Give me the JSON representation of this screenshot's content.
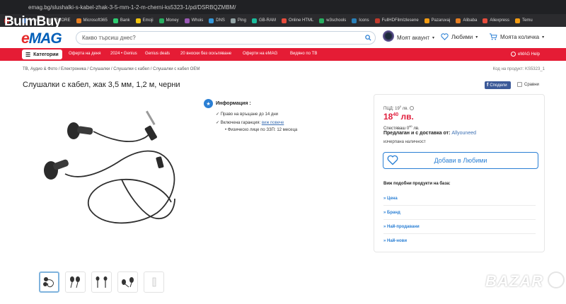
{
  "browser": {
    "url": "emag.bg/slushalki-s-kabel-zhak-3-5-mm-1-2-m-cherni-ks5323-1/pd/DSRBQZMBM/"
  },
  "bookmarks": [
    {
      "label": "Yo",
      "color": "#e52a2a"
    },
    {
      "label": "Google",
      "color": "#4a8ef0"
    },
    {
      "label": "SCORE",
      "color": "#888888"
    },
    {
      "label": "Microsoft365",
      "color": "#e67e22"
    },
    {
      "label": "Bank",
      "color": "#2ecc71"
    },
    {
      "label": "Emoji",
      "color": "#f1c40f"
    },
    {
      "label": "Money",
      "color": "#27ae60"
    },
    {
      "label": "Whois",
      "color": "#9b59b6"
    },
    {
      "label": "DNS",
      "color": "#3498db"
    },
    {
      "label": "Ping",
      "color": "#95a5a6"
    },
    {
      "label": "GB-RAM",
      "color": "#1abc9c"
    },
    {
      "label": "Online HTML",
      "color": "#e74c3c"
    },
    {
      "label": "w3schools",
      "color": "#27ae60"
    },
    {
      "label": "Icons",
      "color": "#2980b9"
    },
    {
      "label": "FullHDFilmIzlesene",
      "color": "#c0392b"
    },
    {
      "label": "Pazaruvaj",
      "color": "#f39c12"
    },
    {
      "label": "Alibaba",
      "color": "#e67e22"
    },
    {
      "label": "Aliexpress",
      "color": "#e74c3c"
    },
    {
      "label": "Temu",
      "color": "#f39c12"
    }
  ],
  "watermarks": {
    "top": "BuimBuy",
    "bottom": "BAZAR"
  },
  "header": {
    "logo": "eMAG",
    "search_placeholder": "Какво търсиш днес?",
    "account_label": "Моят акаунт",
    "favorites_label": "Любими",
    "cart_label": "Моята количка"
  },
  "nav": {
    "categories_label": "Категории",
    "links": [
      "Оферта на деня",
      "2024 • Genius",
      "Genius deals",
      "20 вноски без оскъпяване",
      "Оферти на eMAG",
      "Видяно по ТВ"
    ],
    "help_label": "eMAG Help"
  },
  "breadcrumb": "ТВ, Аудио & Фото  /  Електроника  /  Слушалки  /  Слушалки с кабел  /  Слушалки с кабел OEM",
  "product_code": "Код на продукт: KS5323_1",
  "product": {
    "title": "Слушалки с кабел, жак 3,5 мм, 1,2 м, черни",
    "share_label": "Сподели",
    "compare_label": "Сравни"
  },
  "info": {
    "title": "Информация :",
    "return_text": "Право на връщане до 14 дни",
    "warranty_text": "Включена гаранция:",
    "warranty_link": "виж повече",
    "warranty_detail": "Физическо лице по ЗЗП: 12 месеца"
  },
  "pricing": {
    "pp_label": "ПЦД: 19",
    "pp_sup": "0",
    "pp_suffix": "лв.",
    "price_int": "18",
    "price_sup": "40",
    "price_suffix": "лв.",
    "saved_label": "Спестяваш 0",
    "saved_sup": "60",
    "saved_suffix": "лв.",
    "offered_label": "Предлаган и с доставка от:",
    "seller": "Allyouneed",
    "stock": "изчерпана наличност",
    "favorite_button": "Добави в Любими"
  },
  "similar": {
    "title": "Виж подобни продукти на база:",
    "links": [
      "» Цена",
      "» Бранд",
      "» Най-продавани",
      "» Най-нови"
    ]
  }
}
